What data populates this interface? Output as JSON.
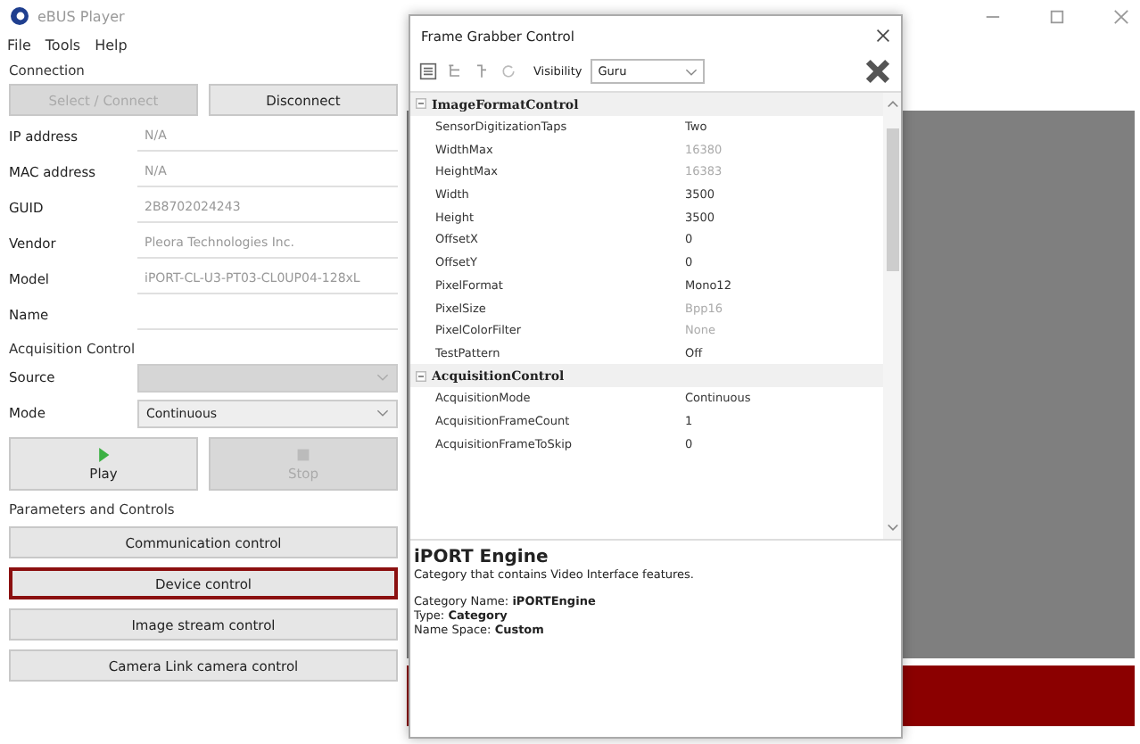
{
  "window": {
    "title": "eBUS Player"
  },
  "menu": [
    "File",
    "Tools",
    "Help"
  ],
  "connection": {
    "title": "Connection",
    "buttons": [
      {
        "label": "Select / Connect",
        "disabled": true
      },
      {
        "label": "Disconnect",
        "disabled": false
      }
    ],
    "fields": [
      {
        "label": "IP address",
        "value": "N/A",
        "readonly": true
      },
      {
        "label": "MAC address",
        "value": "N/A",
        "readonly": true
      },
      {
        "label": "GUID",
        "value": "2B8702024243",
        "readonly": true
      },
      {
        "label": "Vendor",
        "value": "Pleora Technologies Inc.",
        "readonly": true
      },
      {
        "label": "Model",
        "value": "iPORT-CL-U3-PT03-CL0UP04-128xL",
        "readonly": true
      },
      {
        "label": "Name"
      }
    ]
  },
  "acquisition": {
    "title": "Acquisition Control",
    "source": {
      "label": "Source",
      "disabled": true
    },
    "mode": {
      "label": "Mode",
      "value": "Continuous"
    },
    "buttons": [
      {
        "label": "Play",
        "kind": "play",
        "disabled": false
      },
      {
        "label": "Stop",
        "kind": "stop",
        "disabled": true
      }
    ]
  },
  "parameters": {
    "title": "Parameters and Controls",
    "buttons": [
      {
        "label": "Communication control",
        "selected": false
      },
      {
        "label": "Device control",
        "selected": true
      },
      {
        "label": "Image stream control",
        "selected": false
      },
      {
        "label": "Camera Link camera control",
        "selected": false
      }
    ]
  },
  "dialog": {
    "title": "Frame Grabber Control",
    "visibility": {
      "label": "Visibility",
      "value": "Guru"
    },
    "groups": [
      {
        "name": "ImageFormatControl",
        "expanded": true,
        "rows": [
          {
            "name": "SensorDigitizationTaps",
            "value": "Two",
            "readonly": false
          },
          {
            "name": "WidthMax",
            "value": "16380",
            "readonly": true
          },
          {
            "name": "HeightMax",
            "value": "16383",
            "readonly": true
          },
          {
            "name": "Width",
            "value": "3500",
            "readonly": false
          },
          {
            "name": "Height",
            "value": "3500",
            "readonly": false
          },
          {
            "name": "OffsetX",
            "value": "0",
            "readonly": false
          },
          {
            "name": "OffsetY",
            "value": "0",
            "readonly": false
          },
          {
            "name": "PixelFormat",
            "value": "Mono12",
            "readonly": false
          },
          {
            "name": "PixelSize",
            "value": "Bpp16",
            "readonly": true
          },
          {
            "name": "PixelColorFilter",
            "value": "None",
            "readonly": true
          },
          {
            "name": "TestPattern",
            "value": "Off",
            "readonly": false
          }
        ]
      },
      {
        "name": "AcquisitionControl",
        "expanded": true,
        "rows": [
          {
            "name": "AcquisitionMode",
            "value": "Continuous",
            "readonly": false
          },
          {
            "name": "AcquisitionFrameCount",
            "value": "1",
            "readonly": false
          },
          {
            "name": "AcquisitionFrameToSkip",
            "value": "0",
            "readonly": false
          }
        ]
      }
    ],
    "description": {
      "title": "iPORT Engine",
      "text": "Category that contains Video Interface features.",
      "lines": [
        "Category Name: **iPORTEngine**",
        "Type: **Category**",
        "Name Space: **Custom**"
      ]
    }
  }
}
